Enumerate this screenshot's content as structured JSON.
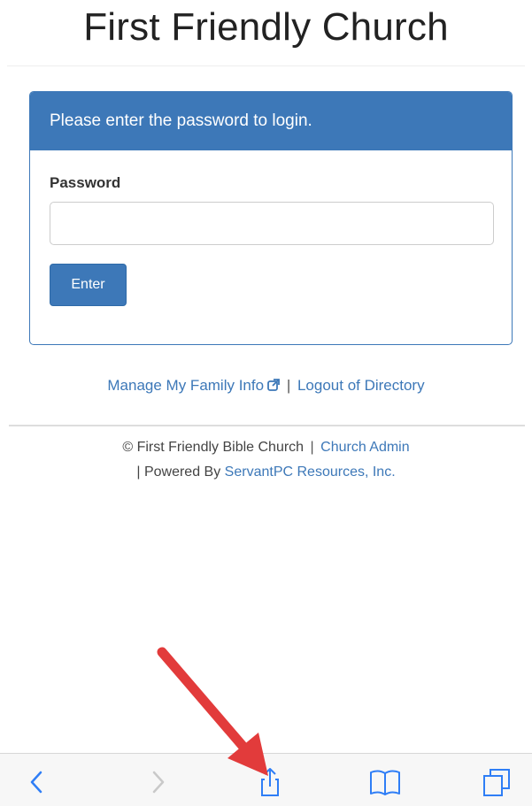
{
  "header": {
    "title": "First Friendly Church"
  },
  "login": {
    "heading": "Please enter the password to login.",
    "password_label": "Password",
    "password_value": "",
    "password_placeholder": "",
    "submit_label": "Enter"
  },
  "links": {
    "manage_family": "Manage My Family Info",
    "separator": "|",
    "logout": "Logout of Directory"
  },
  "footer": {
    "copyright": "© First Friendly Bible Church",
    "separator1": "|",
    "church_admin": "Church Admin",
    "powered_prefix": "| Powered By",
    "servantpc": "ServantPC Resources, Inc."
  },
  "toolbar": {
    "back_icon": "chevron-left-icon",
    "forward_icon": "chevron-right-icon",
    "share_icon": "share-icon",
    "bookmarks_icon": "book-icon",
    "tabs_icon": "tabs-icon"
  },
  "colors": {
    "primary": "#3d78b8",
    "annotation_arrow": "#e23b3b",
    "toolbar_bg": "#f7f7f7"
  }
}
